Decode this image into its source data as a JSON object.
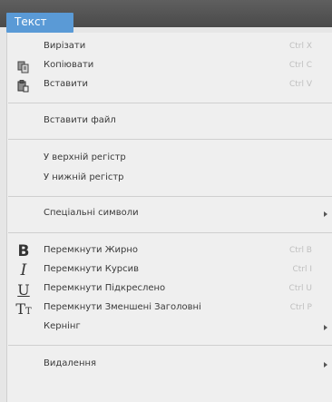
{
  "menubar": {
    "title": "Текст"
  },
  "menu": {
    "items": [
      {
        "label": "Вирізати",
        "shortcut": "Ctrl X"
      },
      {
        "label": "Копіювати",
        "shortcut": "Ctrl C",
        "icon": "copy-icon"
      },
      {
        "label": "Вставити",
        "shortcut": "Ctrl V",
        "icon": "paste-icon"
      },
      {
        "label": "Вставити файл"
      },
      {
        "label": "У верхній регістр"
      },
      {
        "label": "У нижній регістр"
      },
      {
        "label": "Спеціальні символи"
      },
      {
        "label": "Перемкнути Жирно",
        "shortcut": "Ctrl B",
        "icon": "bold-icon"
      },
      {
        "label": "Перемкнути Курсив",
        "shortcut": "Ctrl I",
        "icon": "italic-icon"
      },
      {
        "label": "Перемкнути Підкреслено",
        "shortcut": "Ctrl U",
        "icon": "underline-icon"
      },
      {
        "label": "Перемкнути Зменшені Заголовні",
        "shortcut": "Ctrl P",
        "icon": "small-caps-icon"
      },
      {
        "label": "Кернінг"
      },
      {
        "label": "Видалення"
      }
    ]
  }
}
